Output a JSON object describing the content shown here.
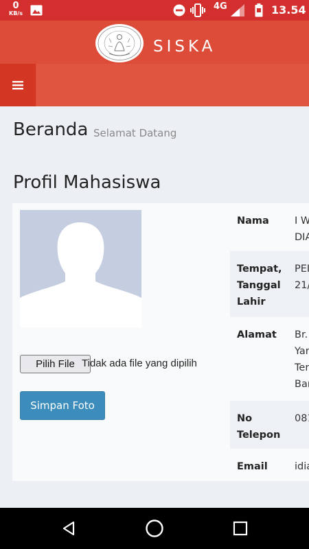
{
  "status_bar": {
    "speed_value": "0",
    "speed_unit": "KB/s",
    "network": "4G",
    "time": "13.54",
    "icons": [
      "image-icon",
      "dnd-icon",
      "vibrate-icon",
      "signal-icon",
      "battery-icon"
    ]
  },
  "header": {
    "brand": "SISKA",
    "color": "#dd4b39"
  },
  "content": {
    "title": "Beranda",
    "subtitle": "Selamat Datang",
    "section_title": "Profil Mahasiswa"
  },
  "photo": {
    "choose_file_label": "Pilih File",
    "no_file_text": "Tidak ada file yang dipilih",
    "save_label": "Simpan Foto"
  },
  "profile": {
    "rows": [
      {
        "label": "Nama",
        "value": "I W\nDIA"
      },
      {
        "label": "Tempat,\nTanggal\nLahir",
        "value": "PEI\n21/"
      },
      {
        "label": "Alamat",
        "value": "Br.\nYar\nTer\nBar"
      },
      {
        "label": "No\nTelepon",
        "value": "081"
      },
      {
        "label": "Email",
        "value": "idia"
      }
    ]
  },
  "colors": {
    "primary_button": "#3c8dbc",
    "header": "#dd4b39",
    "status_bar": "#d32f2f"
  }
}
